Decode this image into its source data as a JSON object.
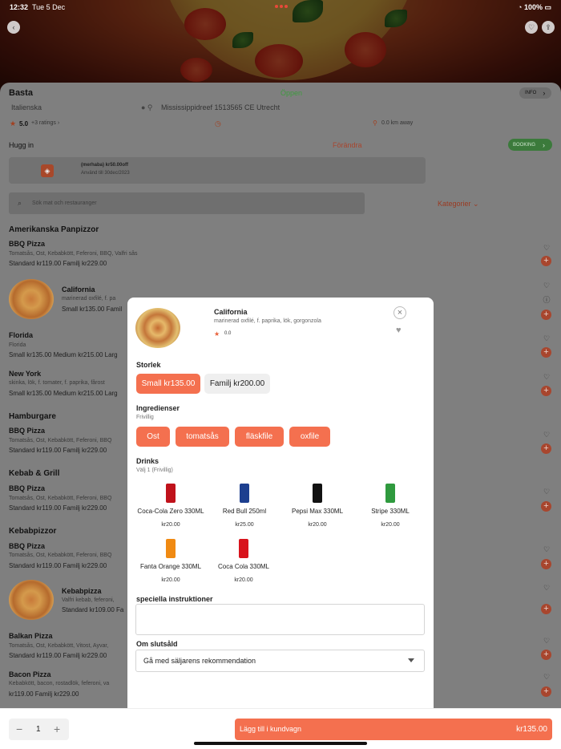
{
  "status_bar": {
    "time": "12:32",
    "date": "Tue 5 Dec",
    "battery": "100%"
  },
  "restaurant": {
    "name": "Basta",
    "status": "Öppen",
    "cuisine": "Italienska",
    "address": "Mississippidreef 1513565 CE Utrecht",
    "rating": "5.0",
    "ratings_count": "+3 ratings",
    "distance": "0.0 km away",
    "info_label": "INFO",
    "order_type": "Hugg in",
    "change_label": "Förändra",
    "booking_label": "BOOKING"
  },
  "coupon": {
    "code": "(merhaba) kr50.00off",
    "valid": "Använd till 30dec/2023"
  },
  "search": {
    "placeholder": "Sök mat och restauranger",
    "categories_label": "Kategorier"
  },
  "menu": {
    "section1": "Amerikanska Panpizzor",
    "bbq1": {
      "name": "BBQ Pizza",
      "desc": "Tomatsås, Ost, Kebabkött, Feferoni, BBQ, Valfri sås",
      "prices": "Standard kr119.00   Familj kr229.00"
    },
    "california": {
      "name": "California",
      "desc": "marinerad oxfilé, f. pa",
      "prices": "Small kr135.00   Famil"
    },
    "florida": {
      "name": "Florida",
      "desc": "Florida",
      "prices": "Small kr135.00   Medium kr215.00   Larg"
    },
    "newyork": {
      "name": "New York",
      "desc": "skinka, lök, f. tomater, f. paprika, fårost",
      "prices": "Small kr135.00   Medium kr215.00   Larg"
    },
    "section2": "Hamburgare",
    "bbq2": {
      "name": "BBQ Pizza",
      "desc": "Tomatsås, Ost, Kebabkött, Feferoni, BBQ",
      "prices": "Standard kr119.00   Familj kr229.00"
    },
    "section3": "Kebab & Grill",
    "bbq3": {
      "name": "BBQ Pizza",
      "desc": "Tomatsås, Ost, Kebabkött, Feferoni, BBQ",
      "prices": "Standard kr119.00   Familj kr229.00"
    },
    "section4": "Kebabpizzor",
    "bbq4": {
      "name": "BBQ Pizza",
      "desc": "Tomatsås, Ost, Kebabkött, Feferoni, BBQ",
      "prices": "Standard kr119.00   Familj kr229.00"
    },
    "kebabpizza": {
      "name": "Kebabpizza",
      "desc": "Valfri kebab, feferoni,",
      "prices": "Standard kr109.00   Fa"
    },
    "balkan": {
      "name": "Balkan Pizza",
      "desc": "Tomatsås, Ost, Kebabkött, Vitost, Ayvar,",
      "prices": "Standard kr119.00   Familj kr229.00"
    },
    "bacon": {
      "name": "Bacon Pizza",
      "desc": "Kebabkött, bacon, rostadlök, feferoni, va",
      "prices": "kr119.00   Familj kr229.00"
    }
  },
  "modal": {
    "title": "California",
    "desc": "marinerad oxfilé, f. paprika, lök, gorgonzola",
    "rating": "0.0",
    "size_title": "Storlek",
    "sizes": [
      "Small kr135.00",
      "Familj kr200.00"
    ],
    "ingredients_title": "Ingredienser",
    "ingredients_sub": "Frivillig",
    "ingredients": [
      "Ost",
      "tomatsås",
      "fläskfile",
      "oxfile"
    ],
    "drinks_title": "Drinks",
    "drinks_sub": "Välj 1   (Frivillig)",
    "drinks": [
      {
        "name": "Coca-Cola Zero 330ML",
        "price": "kr20.00",
        "color": "#c0121b"
      },
      {
        "name": "Red Bull 250ml",
        "price": "kr25.00",
        "color": "#1d3f8f"
      },
      {
        "name": "Pepsi Max 330ML",
        "price": "kr20.00",
        "color": "#121212"
      },
      {
        "name": "Stripe 330ML",
        "price": "kr20.00",
        "color": "#2f9a3e"
      },
      {
        "name": "Fanta Orange 330ML",
        "price": "kr20.00",
        "color": "#f08a12"
      },
      {
        "name": "Coca Cola 330ML",
        "price": "kr20.00",
        "color": "#d8131c"
      }
    ],
    "instructions_title": "speciella instruktioner",
    "soldout_title": "Om slutsåld",
    "soldout_value": "Gå med säljarens rekommendation"
  },
  "bottom": {
    "quantity": "1",
    "add_label": "Lägg till i kundvagn",
    "total": "kr135.00"
  },
  "colors": {
    "accent": "#f4704f",
    "open_green": "#3f9a3f"
  }
}
